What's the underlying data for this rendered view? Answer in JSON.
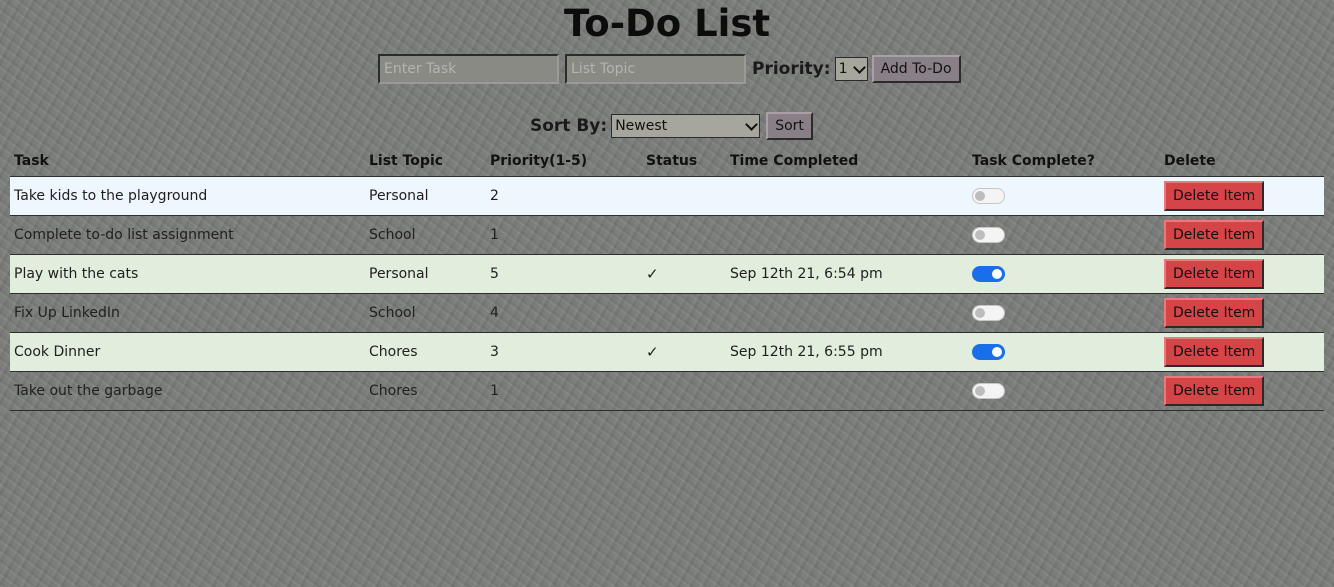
{
  "page": {
    "title": "To-Do List"
  },
  "add_form": {
    "task_placeholder": "Enter Task",
    "topic_placeholder": "List Topic",
    "priority_label": "Priority:",
    "priority_value": "1",
    "add_button": "Add To-Do"
  },
  "sort_form": {
    "label": "Sort By:",
    "value": "Newest",
    "button": "Sort"
  },
  "table": {
    "headers": [
      "Task",
      "List Topic",
      "Priority(1-5)",
      "Status",
      "Time Completed",
      "Task Complete?",
      "Delete"
    ],
    "rows": [
      {
        "task": "Take kids to the playground",
        "topic": "Personal",
        "priority": "2",
        "status": "",
        "time": "",
        "complete": false,
        "delete": "Delete Item"
      },
      {
        "task": "Complete to-do list assignment",
        "topic": "School",
        "priority": "1",
        "status": "",
        "time": "",
        "complete": false,
        "delete": "Delete Item"
      },
      {
        "task": "Play with the cats",
        "topic": "Personal",
        "priority": "5",
        "status": "✓",
        "time": "Sep 12th 21, 6:54 pm",
        "complete": true,
        "delete": "Delete Item"
      },
      {
        "task": "Fix Up LinkedIn",
        "topic": "School",
        "priority": "4",
        "status": "",
        "time": "",
        "complete": false,
        "delete": "Delete Item"
      },
      {
        "task": "Cook Dinner",
        "topic": "Chores",
        "priority": "3",
        "status": "✓",
        "time": "Sep 12th 21, 6:55 pm",
        "complete": true,
        "delete": "Delete Item"
      },
      {
        "task": "Take out the garbage",
        "topic": "Chores",
        "priority": "1",
        "status": "",
        "time": "",
        "complete": false,
        "delete": "Delete Item"
      }
    ]
  },
  "colors": {
    "background": "#7b7d7a",
    "hover_row": "#eef6fe",
    "completed_row": "#e1eedd",
    "delete_button": "#d54447",
    "toggle_on": "#1a6ee8",
    "add_button": "#897f86"
  }
}
